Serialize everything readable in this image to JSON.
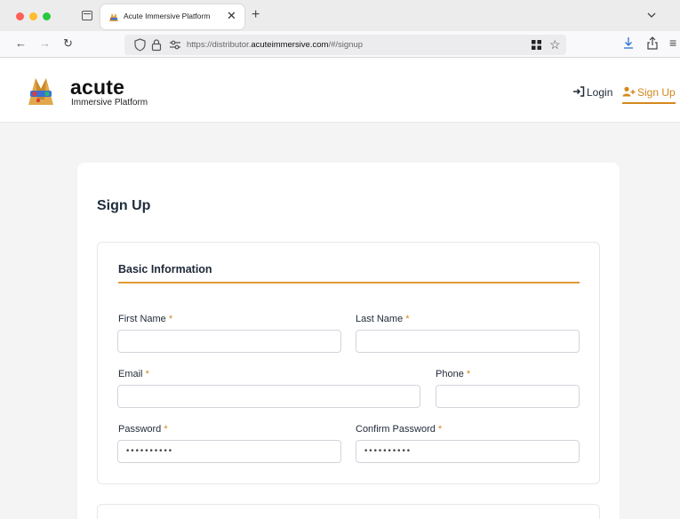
{
  "browser": {
    "tab_title": "Acute Immersive Platform",
    "tab_close": "✕",
    "new_tab": "+",
    "nav": {
      "back": "←",
      "forward": "→",
      "reload": "↻"
    },
    "url_host_prefix": "https://distributor.",
    "url_host_main": "acuteimmersive.com",
    "url_path": "/#/signup",
    "bookmark_icon": "☆",
    "menu_icon": "≡",
    "icons": [
      "shield-icon",
      "lock-icon",
      "permissions-icon",
      "qr-code-icon",
      "download-icon",
      "share-icon",
      "tab-list-icon"
    ]
  },
  "header": {
    "brand": "acute",
    "brand_subtitle": "Immersive Platform",
    "login_label": "Login",
    "signup_label": "Sign Up",
    "accent_color": "#d4881f"
  },
  "page": {
    "title": "Sign Up"
  },
  "basic_info": {
    "section_title": "Basic Information",
    "required_marker": "*",
    "fields": {
      "first_name": {
        "label": "First Name",
        "value": ""
      },
      "last_name": {
        "label": "Last Name",
        "value": ""
      },
      "email": {
        "label": "Email",
        "value": ""
      },
      "phone": {
        "label": "Phone",
        "value": ""
      },
      "password": {
        "label": "Password",
        "value": "••••••••••"
      },
      "confirm_password": {
        "label": "Confirm Password",
        "value": "••••••••••"
      }
    }
  }
}
